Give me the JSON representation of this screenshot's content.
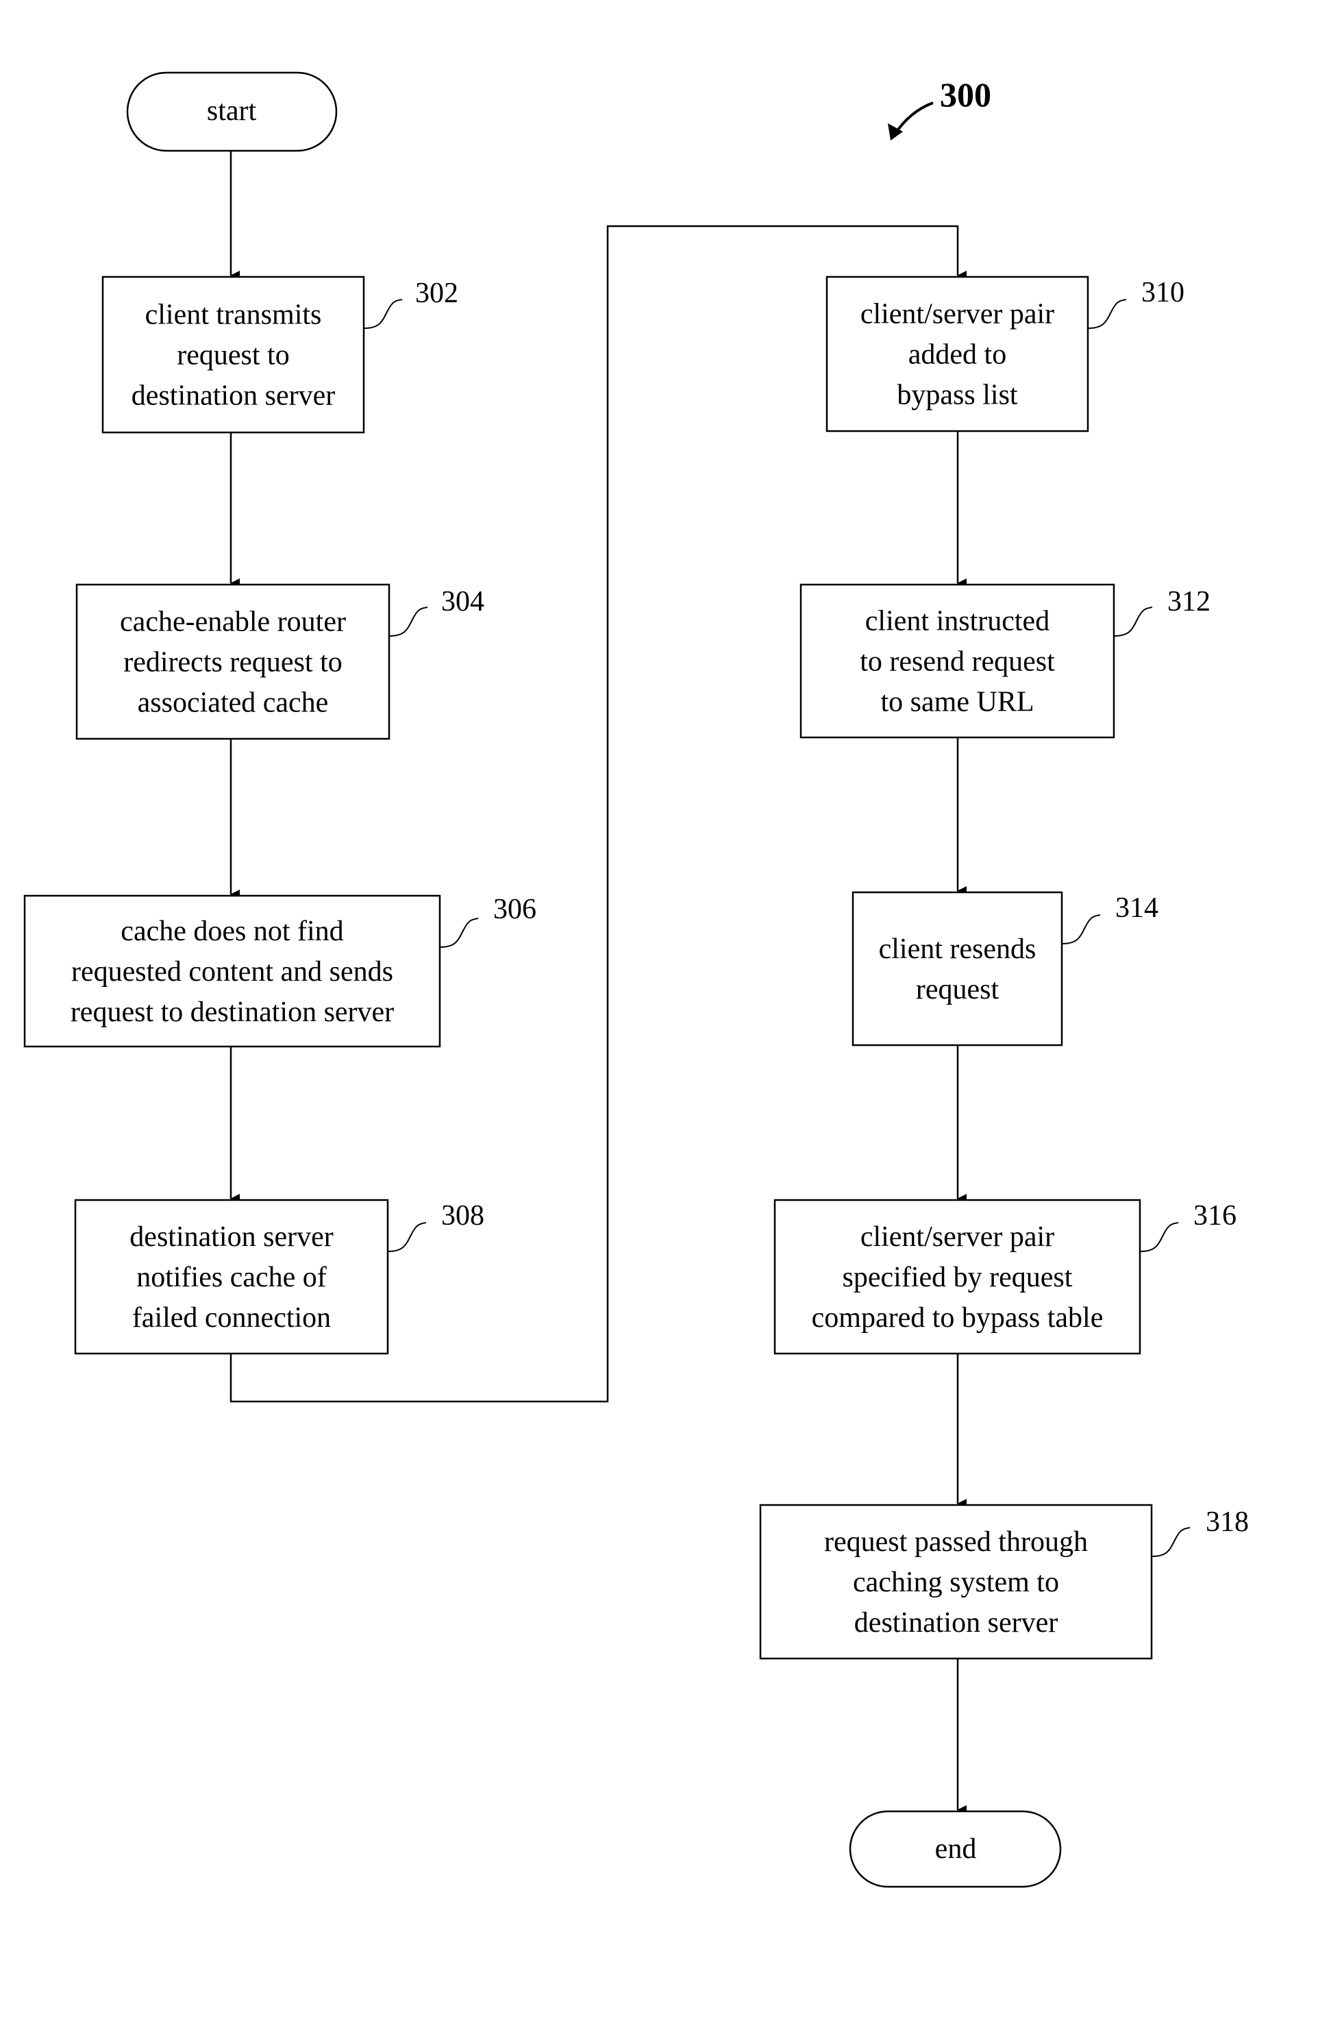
{
  "figure": {
    "number": "300",
    "start_label": "start",
    "end_label": "end",
    "steps": [
      {
        "ref": "302",
        "lines": [
          "client transmits",
          "request to",
          "destination server"
        ]
      },
      {
        "ref": "304",
        "lines": [
          "cache-enable router",
          "redirects request to",
          "associated cache"
        ]
      },
      {
        "ref": "306",
        "lines": [
          "cache does not find",
          "requested content and sends",
          "request to destination server"
        ]
      },
      {
        "ref": "308",
        "lines": [
          "destination server",
          "notifies cache of",
          "failed connection"
        ]
      },
      {
        "ref": "310",
        "lines": [
          "client/server pair",
          "added to",
          "bypass list"
        ]
      },
      {
        "ref": "312",
        "lines": [
          "client instructed",
          "to resend request",
          "to same URL"
        ]
      },
      {
        "ref": "314",
        "lines": [
          "client resends",
          "request"
        ]
      },
      {
        "ref": "316",
        "lines": [
          "client/server pair",
          "specified by request",
          "compared to bypass table"
        ]
      },
      {
        "ref": "318",
        "lines": [
          "request passed through",
          "caching system to",
          "destination server"
        ]
      }
    ]
  }
}
